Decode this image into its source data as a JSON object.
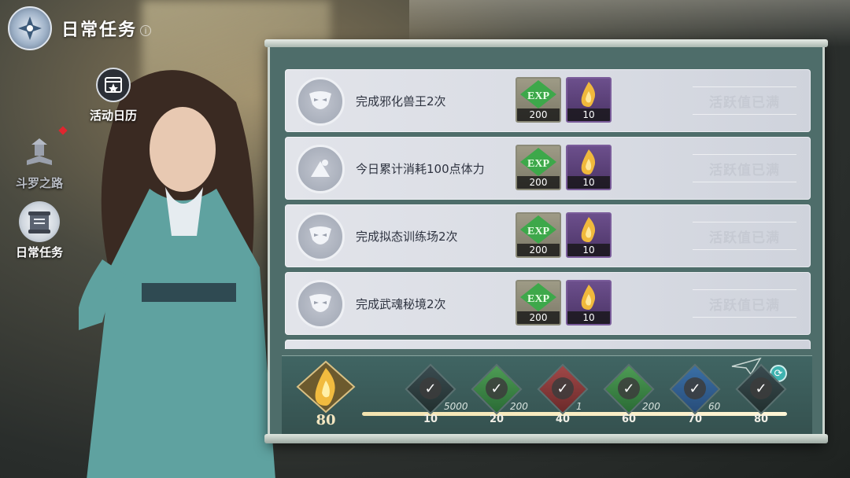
{
  "header": {
    "title": "日常任务",
    "info_symbol": "i"
  },
  "nav": {
    "items": [
      {
        "label": "活动日历",
        "icon": "calendar-star-icon",
        "state": "normal"
      },
      {
        "label": "斗罗之路",
        "icon": "book-pagoda-icon",
        "state": "dim",
        "badge": true
      },
      {
        "label": "日常任务",
        "icon": "scroll-icon",
        "state": "active"
      }
    ]
  },
  "tasks": [
    {
      "text": "完成邪化兽王2次",
      "icon": "beast-mask-icon",
      "exp": "200",
      "activity": "10",
      "status": "活跃值已满"
    },
    {
      "text": "今日累计消耗100点体力",
      "icon": "stamina-icon",
      "exp": "200",
      "activity": "10",
      "status": "活跃值已满"
    },
    {
      "text": "完成拟态训练场2次",
      "icon": "beast-mask-icon",
      "exp": "200",
      "activity": "10",
      "status": "活跃值已满"
    },
    {
      "text": "完成武魂秘境2次",
      "icon": "beast-mask-icon",
      "exp": "200",
      "activity": "10",
      "status": "活跃值已满"
    }
  ],
  "reward_labels": {
    "exp_text": "EXP"
  },
  "progress": {
    "points": "80",
    "fill_fraction": 1.0,
    "milestones": [
      {
        "threshold": "10",
        "amount": "5000",
        "reward": "coin",
        "claimed": true
      },
      {
        "threshold": "20",
        "amount": "200",
        "reward": "exp",
        "claimed": true
      },
      {
        "threshold": "40",
        "amount": "1",
        "reward": "box",
        "claimed": true
      },
      {
        "threshold": "60",
        "amount": "200",
        "reward": "exp",
        "claimed": true
      },
      {
        "threshold": "70",
        "amount": "60",
        "reward": "crystal",
        "claimed": true
      },
      {
        "threshold": "80",
        "amount": "",
        "reward": "chest",
        "claimed": true
      }
    ],
    "check_symbol": "✓",
    "refresh_symbol": "⟳"
  },
  "colors": {
    "panel": "#4e6d6a",
    "task_bg": "#dcdfe6",
    "status_text": "#c6cad3",
    "gold": "#f4e6c0"
  }
}
